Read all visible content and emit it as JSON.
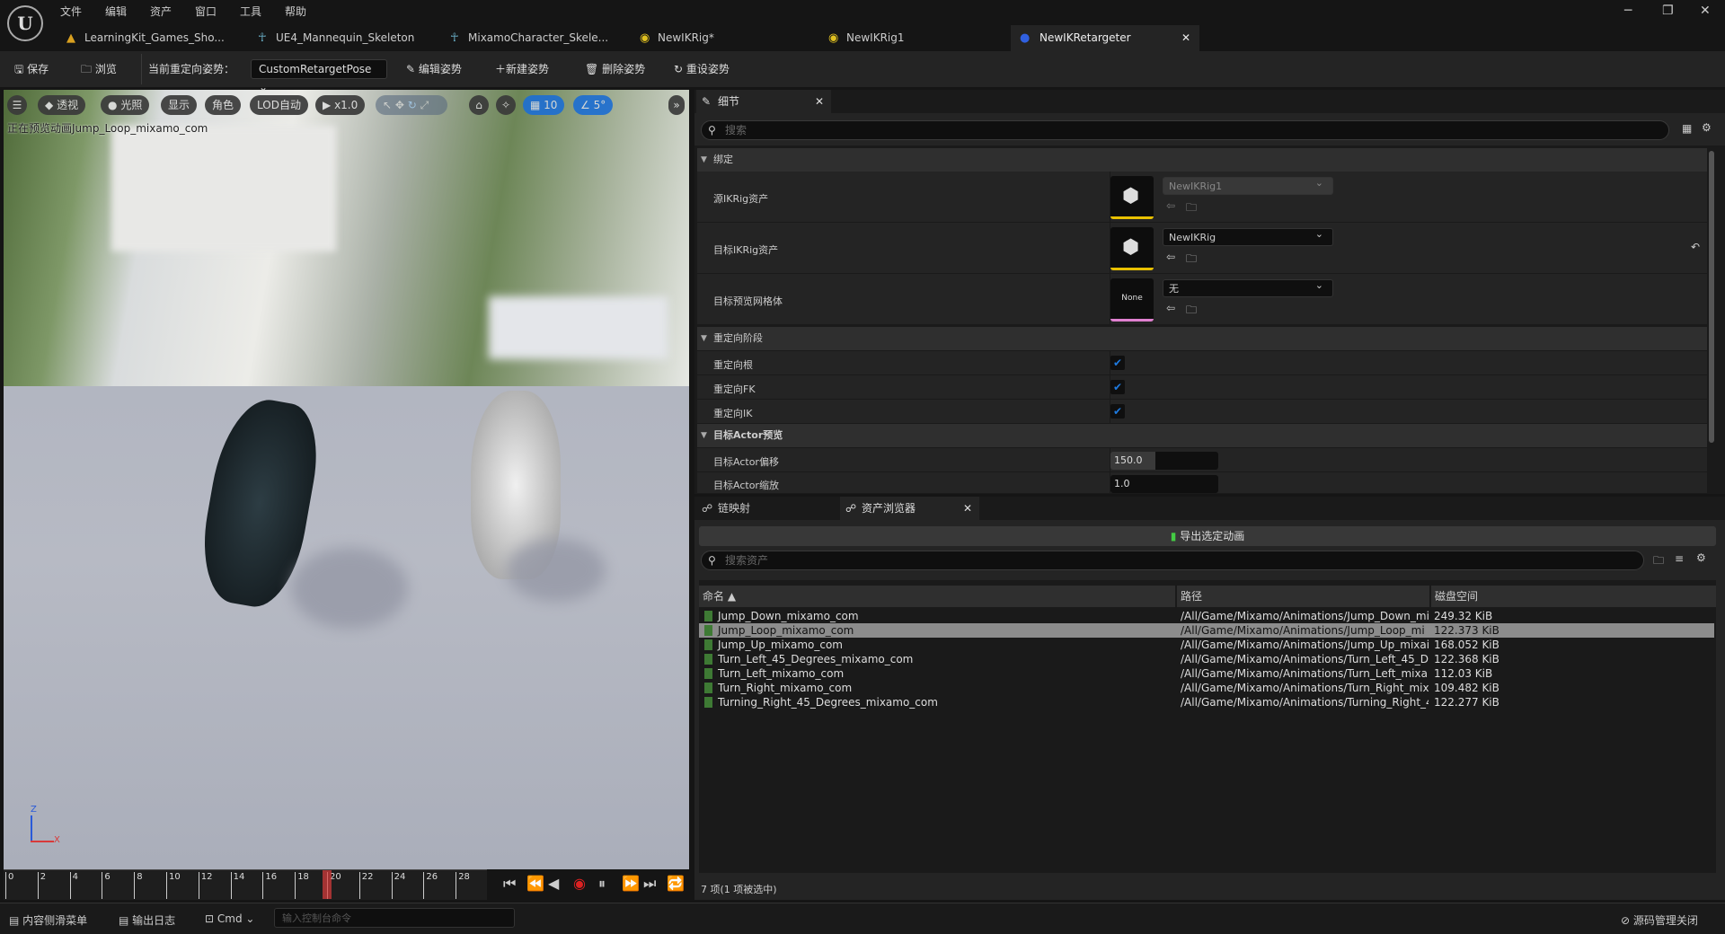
{
  "menu": [
    "文件",
    "编辑",
    "资产",
    "窗口",
    "工具",
    "帮助"
  ],
  "tabs": [
    {
      "label": "LearningKit_Games_Sho...",
      "icon": "level-icon",
      "color": "#d9a020"
    },
    {
      "label": "UE4_Mannequin_Skeleton",
      "icon": "skeleton-icon",
      "color": "#6ab0c8"
    },
    {
      "label": "MixamoCharacter_Skele...",
      "icon": "skeleton-icon",
      "color": "#6ab0c8"
    },
    {
      "label": "NewIKRig*",
      "icon": "ikrig-icon",
      "color": "#e0c020"
    },
    {
      "label": "NewIKRig1",
      "icon": "ikrig-icon",
      "color": "#e0c020"
    },
    {
      "label": "NewIKRetargeter",
      "icon": "retargeter-icon",
      "color": "#3060e0"
    }
  ],
  "toolbar": {
    "save": "保存",
    "browse": "浏览",
    "pose_label": "当前重定向姿势：",
    "pose_value": "CustomRetargetPose",
    "edit_pose": "编辑姿势",
    "new_pose": "新建姿势",
    "delete_pose": "删除姿势",
    "reset_pose": "重设姿势"
  },
  "viewport": {
    "perspective": "透视",
    "lighting": "光照",
    "show": "显示",
    "character": "角色",
    "lod": "LOD自动",
    "speed": "x1.0",
    "grid_snap": "10",
    "angle_snap": "5°",
    "preview_text": "正在预览动画Jump_Loop_mixamo_com",
    "axis_x": "X",
    "axis_z": "Z"
  },
  "timeline": {
    "ticks": [
      "0",
      "2",
      "4",
      "6",
      "8",
      "10",
      "12",
      "14",
      "16",
      "18",
      "20",
      "22",
      "24",
      "26",
      "28"
    ],
    "current_frame": 20
  },
  "details": {
    "tab": "细节",
    "search_placeholder": "搜索",
    "sections": {
      "binding": "绑定",
      "phases": "重定向阶段",
      "actor_preview": "目标Actor预览"
    },
    "source_ik": {
      "label": "源IKRig资产",
      "value": "NewIKRig1"
    },
    "target_ik": {
      "label": "目标IKRig资产",
      "value": "NewIKRig"
    },
    "preview_mesh": {
      "label": "目标预览网格体",
      "value": "无",
      "thumb": "None"
    },
    "retarget_root": {
      "label": "重定向根",
      "checked": true
    },
    "retarget_fk": {
      "label": "重定向FK",
      "checked": true
    },
    "retarget_ik": {
      "label": "重定向IK",
      "checked": true
    },
    "offset": {
      "label": "目标Actor偏移",
      "value": "150.0"
    },
    "scale": {
      "label": "目标Actor缩放",
      "value": "1.0"
    }
  },
  "assets": {
    "tab_chain": "链映射",
    "tab_browser": "资产浏览器",
    "export": "导出选定动画",
    "search_placeholder": "搜索资产",
    "columns": [
      "命名 ▲",
      "路径",
      "磁盘空间"
    ],
    "rows": [
      {
        "name": "Jump_Down_mixamo_com",
        "path": "/All/Game/Mixamo/Animations/Jump_Down_mi",
        "size": "249.32 KiB"
      },
      {
        "name": "Jump_Loop_mixamo_com",
        "path": "/All/Game/Mixamo/Animations/Jump_Loop_mi",
        "size": "122.373 KiB",
        "selected": true
      },
      {
        "name": "Jump_Up_mixamo_com",
        "path": "/All/Game/Mixamo/Animations/Jump_Up_mixai",
        "size": "168.052 KiB"
      },
      {
        "name": "Turn_Left_45_Degrees_mixamo_com",
        "path": "/All/Game/Mixamo/Animations/Turn_Left_45_D",
        "size": "122.368 KiB"
      },
      {
        "name": "Turn_Left_mixamo_com",
        "path": "/All/Game/Mixamo/Animations/Turn_Left_mixa",
        "size": "112.03 KiB"
      },
      {
        "name": "Turn_Right_mixamo_com",
        "path": "/All/Game/Mixamo/Animations/Turn_Right_mix",
        "size": "109.482 KiB"
      },
      {
        "name": "Turning_Right_45_Degrees_mixamo_com",
        "path": "/All/Game/Mixamo/Animations/Turning_Right_4",
        "size": "122.277 KiB"
      }
    ],
    "count": "7 项(1 项被选中)"
  },
  "statusbar": {
    "content_drawer": "内容侧滑菜单",
    "output_log": "输出日志",
    "cmd": "Cmd",
    "console_placeholder": "输入控制台命令",
    "source_control": "源码管理关闭"
  }
}
